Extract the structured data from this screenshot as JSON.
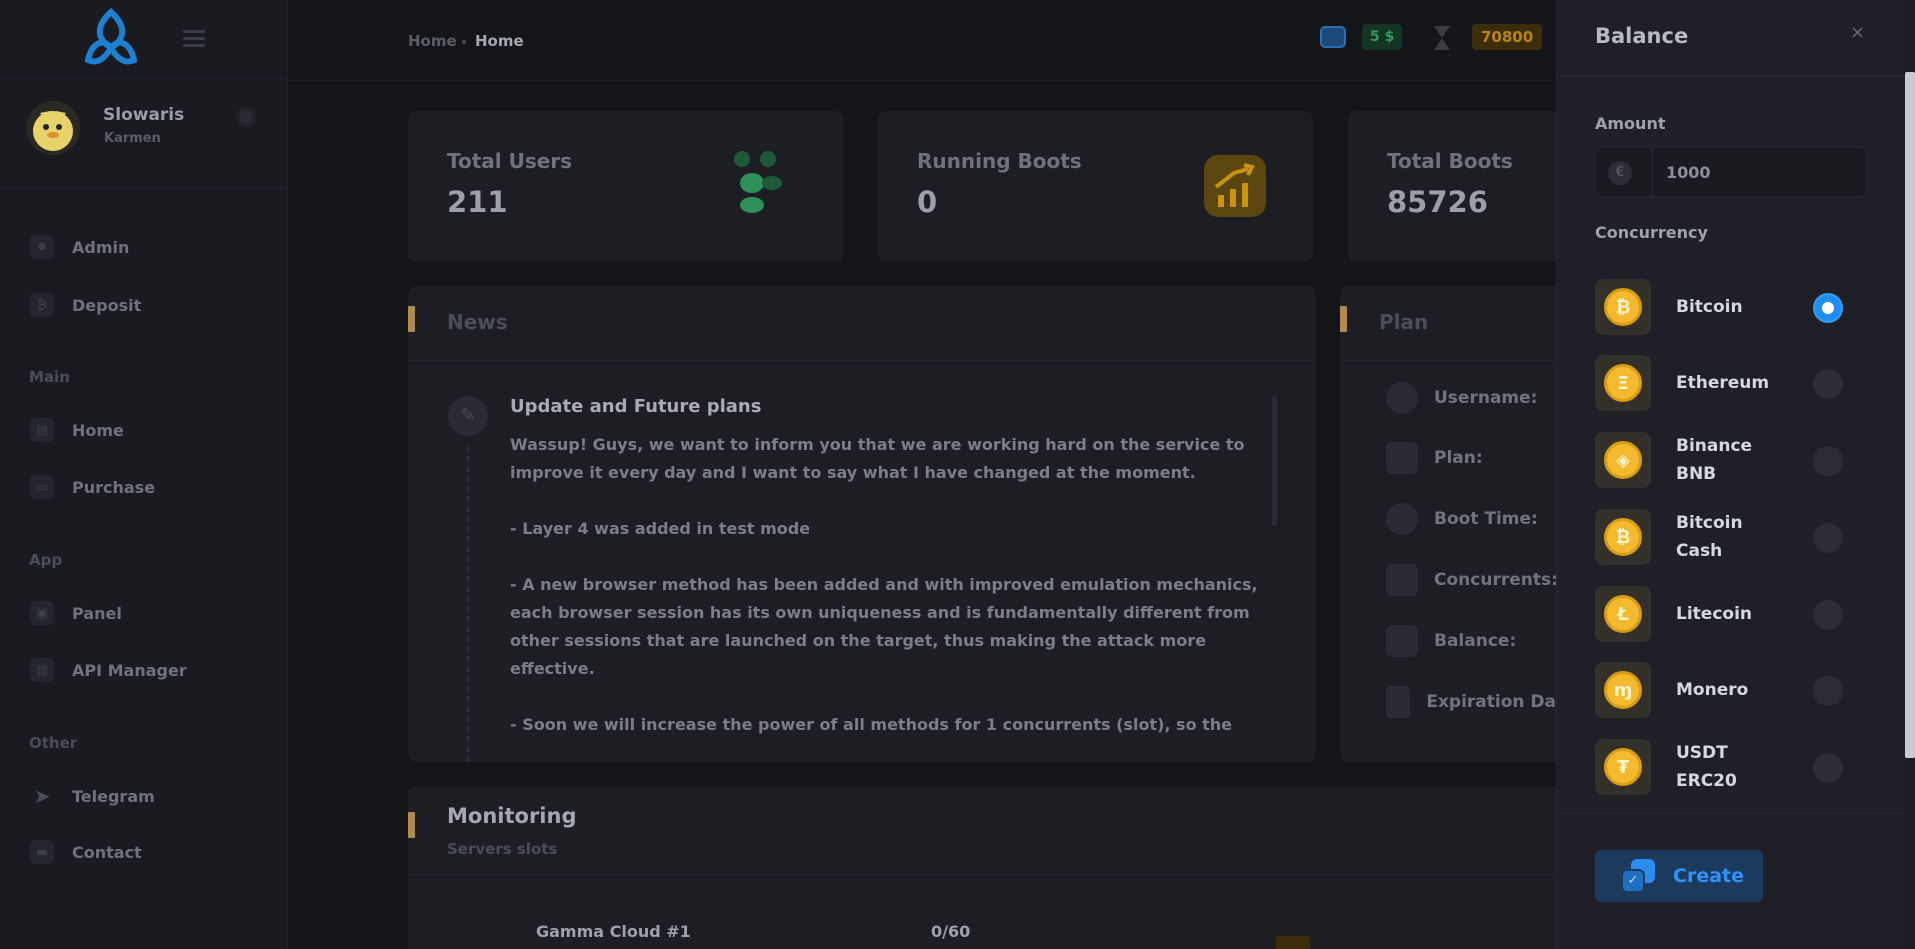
{
  "sidebar": {
    "user": {
      "name": "Slowaris",
      "subtitle": "Karmen"
    },
    "items_top": [
      {
        "label": "Admin",
        "icon": "gear-icon"
      },
      {
        "label": "Deposit",
        "icon": "bitcoin-icon"
      }
    ],
    "sections": [
      {
        "title": "Main",
        "items": [
          {
            "label": "Home",
            "icon": "grid-icon"
          },
          {
            "label": "Purchase",
            "icon": "wallet-icon"
          }
        ]
      },
      {
        "title": "App",
        "items": [
          {
            "label": "Panel",
            "icon": "panel-icon"
          },
          {
            "label": "API Manager",
            "icon": "api-icon"
          }
        ]
      },
      {
        "title": "Other",
        "items": [
          {
            "label": "Telegram",
            "icon": "telegram-icon"
          },
          {
            "label": "Contact",
            "icon": "briefcase-icon"
          }
        ]
      }
    ]
  },
  "header": {
    "breadcrumb": [
      "Home",
      "Home"
    ],
    "wallet_balance": "5 $",
    "time_balance": "70800"
  },
  "stats": [
    {
      "title": "Total Users",
      "value": "211",
      "icon": "users-icon"
    },
    {
      "title": "Running Boots",
      "value": "0",
      "icon": "chart-up-icon"
    },
    {
      "title": "Total Boots",
      "value": "85726",
      "icon": "boots-icon"
    }
  ],
  "news": {
    "title": "News",
    "post_title": "Update and Future plans",
    "paragraphs": [
      "Wassup! Guys, we want to inform you that we are working hard on the service to improve it every day and I want to say what I have changed at the moment.",
      " - Layer 4 was added in test mode",
      " - A new browser method has been added and with improved emulation mechanics, each browser session has its own uniqueness and is fundamentally different from other sessions that are launched on the target, thus making the attack more effective.",
      " - Soon we will increase the power of all methods for 1 concurrents (slot), so the"
    ]
  },
  "plan": {
    "title": "Plan",
    "rows": [
      {
        "label": "Username:",
        "icon": "user-icon"
      },
      {
        "label": "Plan:",
        "icon": "cube-icon"
      },
      {
        "label": "Boot Time:",
        "icon": "clock-icon"
      },
      {
        "label": "Concurrents:",
        "icon": "concurrency-icon"
      },
      {
        "label": "Balance:",
        "icon": "wallet-icon"
      },
      {
        "label": "Expiration Da",
        "icon": "hourglass-icon"
      }
    ]
  },
  "monitoring": {
    "title": "Monitoring",
    "subtitle": "Servers slots",
    "servers": [
      {
        "name": "Gamma Cloud #1",
        "slots": "0/60"
      }
    ]
  },
  "drawer": {
    "title": "Balance",
    "amount_label": "Amount",
    "amount_value": "1000",
    "currency_symbol": "€",
    "concurrency_label": "Concurrency",
    "coins": [
      {
        "line1": "Bitcoin",
        "line2": "",
        "symbol": "₿",
        "selected": true
      },
      {
        "line1": "Ethereum",
        "line2": "",
        "symbol": "Ξ",
        "selected": false
      },
      {
        "line1": "Binance",
        "line2": "BNB",
        "symbol": "◈",
        "selected": false
      },
      {
        "line1": "Bitcoin",
        "line2": "Cash",
        "symbol": "₿",
        "selected": false
      },
      {
        "line1": "Litecoin",
        "line2": "",
        "symbol": "Ł",
        "selected": false
      },
      {
        "line1": "Monero",
        "line2": "",
        "symbol": "ɱ",
        "selected": false
      },
      {
        "line1": "USDT",
        "line2": "ERC20",
        "symbol": "₮",
        "selected": false
      }
    ],
    "create_label": "Create"
  }
}
